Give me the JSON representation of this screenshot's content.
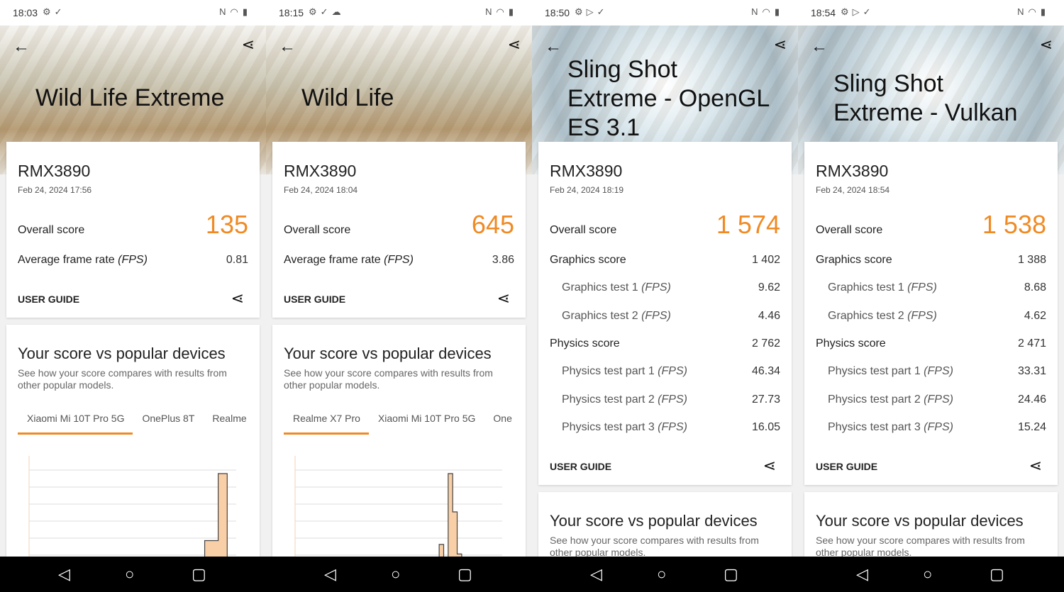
{
  "accent": "#f08a24",
  "panels": [
    {
      "time": "18:03",
      "status_icons": [
        "gear-icon",
        "check-icon"
      ],
      "hero": "wild",
      "title": [
        "Wild Life Extreme"
      ],
      "model": "RMX3890",
      "date": "Feb 24, 2024 17:56",
      "overall_label": "Overall score",
      "overall": "135",
      "rows": [
        {
          "label": "Average frame rate",
          "unit": "(FPS)",
          "value": "0.81",
          "sub": false
        }
      ],
      "user_guide": "USER GUIDE",
      "compare_title": "Your score vs popular devices",
      "compare_sub": "See how your score compares with results from other popular models.",
      "tabs": [
        "Xiaomi Mi 10T Pro 5G",
        "OnePlus 8T",
        "Realme"
      ],
      "hist": [
        0,
        0,
        0,
        0,
        0,
        0,
        0,
        0,
        0,
        0,
        0,
        0,
        0,
        0,
        0,
        0,
        0,
        0,
        0,
        0,
        0,
        0,
        0,
        0,
        0,
        0,
        0,
        0,
        0,
        0,
        0,
        0,
        0,
        0,
        0,
        0,
        10,
        10,
        10,
        30,
        30,
        30,
        100,
        100,
        0,
        0
      ]
    },
    {
      "time": "18:15",
      "status_icons": [
        "gear-icon",
        "check-icon",
        "cloud-icon"
      ],
      "hero": "wild",
      "title": [
        "Wild Life"
      ],
      "model": "RMX3890",
      "date": "Feb 24, 2024 18:04",
      "overall_label": "Overall score",
      "overall": "645",
      "rows": [
        {
          "label": "Average frame rate",
          "unit": "(FPS)",
          "value": "3.86",
          "sub": false
        }
      ],
      "user_guide": "USER GUIDE",
      "compare_title": "Your score vs popular devices",
      "compare_sub": "See how your score compares with results from other popular models.",
      "tabs": [
        "Realme X7 Pro",
        "Xiaomi Mi 10T Pro 5G",
        "One"
      ],
      "hist": [
        0,
        0,
        0,
        0,
        0,
        0,
        8,
        0,
        0,
        8,
        0,
        0,
        0,
        0,
        0,
        0,
        0,
        0,
        6,
        4,
        8,
        0,
        0,
        4,
        2,
        0,
        0,
        12,
        12,
        0,
        0,
        8,
        26,
        0,
        100,
        60,
        16,
        0,
        0,
        0,
        0,
        0,
        0,
        0,
        0,
        0
      ]
    },
    {
      "time": "18:50",
      "status_icons": [
        "gear-icon",
        "play-icon",
        "check-icon"
      ],
      "hero": "alt",
      "title": [
        "Sling Shot",
        "Extreme - OpenGL",
        "ES 3.1"
      ],
      "model": "RMX3890",
      "date": "Feb 24, 2024 18:19",
      "overall_label": "Overall score",
      "overall": "1 574",
      "rows": [
        {
          "label": "Graphics score",
          "unit": "",
          "value": "1 402",
          "sub": false
        },
        {
          "label": "Graphics test 1",
          "unit": "(FPS)",
          "value": "9.62",
          "sub": true
        },
        {
          "label": "Graphics test 2",
          "unit": "(FPS)",
          "value": "4.46",
          "sub": true
        },
        {
          "label": "Physics score",
          "unit": "",
          "value": "2 762",
          "sub": false
        },
        {
          "label": "Physics test part 1",
          "unit": "(FPS)",
          "value": "46.34",
          "sub": true
        },
        {
          "label": "Physics test part 2",
          "unit": "(FPS)",
          "value": "27.73",
          "sub": true
        },
        {
          "label": "Physics test part 3",
          "unit": "(FPS)",
          "value": "16.05",
          "sub": true
        }
      ],
      "user_guide": "USER GUIDE",
      "compare_title": "Your score vs popular devices",
      "compare_sub": "See how your score compares with results from other popular models.",
      "tabs": [],
      "hist": []
    },
    {
      "time": "18:54",
      "status_icons": [
        "gear-icon",
        "play-icon",
        "check-icon"
      ],
      "hero": "alt",
      "title": [
        "Sling Shot",
        "Extreme - Vulkan"
      ],
      "model": "RMX3890",
      "date": "Feb 24, 2024 18:54",
      "overall_label": "Overall score",
      "overall": "1 538",
      "rows": [
        {
          "label": "Graphics score",
          "unit": "",
          "value": "1 388",
          "sub": false
        },
        {
          "label": "Graphics test 1",
          "unit": "(FPS)",
          "value": "8.68",
          "sub": true
        },
        {
          "label": "Graphics test 2",
          "unit": "(FPS)",
          "value": "4.62",
          "sub": true
        },
        {
          "label": "Physics score",
          "unit": "",
          "value": "2 471",
          "sub": false
        },
        {
          "label": "Physics test part 1",
          "unit": "(FPS)",
          "value": "33.31",
          "sub": true
        },
        {
          "label": "Physics test part 2",
          "unit": "(FPS)",
          "value": "24.46",
          "sub": true
        },
        {
          "label": "Physics test part 3",
          "unit": "(FPS)",
          "value": "15.24",
          "sub": true
        }
      ],
      "user_guide": "USER GUIDE",
      "compare_title": "Your score vs popular devices",
      "compare_sub": "See how your score compares with results from other popular models.",
      "tabs": [],
      "hist": []
    }
  ]
}
